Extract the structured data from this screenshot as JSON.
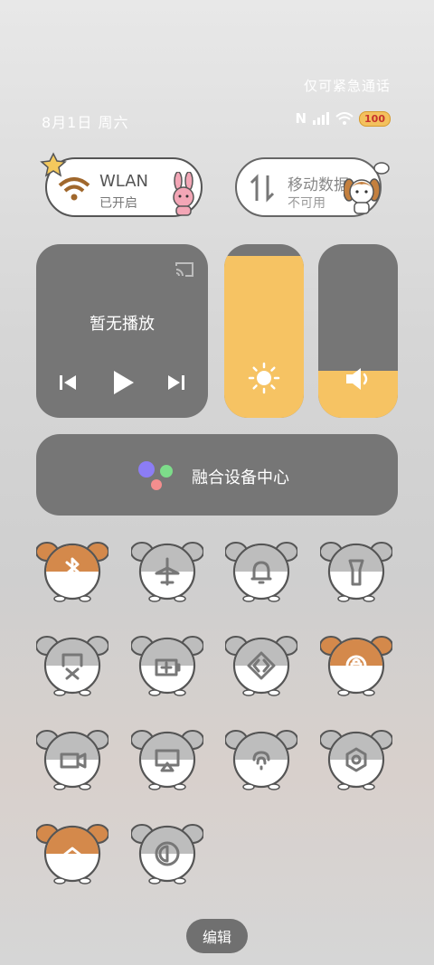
{
  "status": {
    "emergency_text": "仅可紧急通话",
    "date": "8月1日 周六",
    "battery": "100"
  },
  "wlan": {
    "title": "WLAN",
    "state": "已开启",
    "icon": "wifi-icon"
  },
  "mobile_data": {
    "title": "移动数据",
    "state": "不可用",
    "icon": "data-arrows-icon"
  },
  "media": {
    "title": "暂无播放",
    "icons": [
      "cast-icon",
      "previous-icon",
      "play-icon",
      "next-icon"
    ]
  },
  "brightness": {
    "level": 0.93,
    "icon": "sun-icon"
  },
  "volume": {
    "level": 0.27,
    "icon": "speaker-icon"
  },
  "device_center": {
    "label": "融合设备中心"
  },
  "toggles": [
    {
      "name": "bluetooth",
      "active": true
    },
    {
      "name": "airplane-mode",
      "active": false
    },
    {
      "name": "sound",
      "active": false
    },
    {
      "name": "flashlight",
      "active": false
    },
    {
      "name": "screenshot",
      "active": false
    },
    {
      "name": "battery-saver",
      "active": false
    },
    {
      "name": "nfc-share",
      "active": false
    },
    {
      "name": "rotation-lock",
      "active": true
    },
    {
      "name": "screen-record",
      "active": false
    },
    {
      "name": "projection",
      "active": false
    },
    {
      "name": "hotspot",
      "active": false
    },
    {
      "name": "settings",
      "active": false
    },
    {
      "name": "high-performance",
      "active": true
    },
    {
      "name": "eye-comfort",
      "active": false
    }
  ],
  "colors": {
    "active_toggle": "#d4894b",
    "inactive_toggle": "#bdbdbd",
    "accent": "#f6c363",
    "tile": "#767676"
  },
  "edit_button": "编辑"
}
